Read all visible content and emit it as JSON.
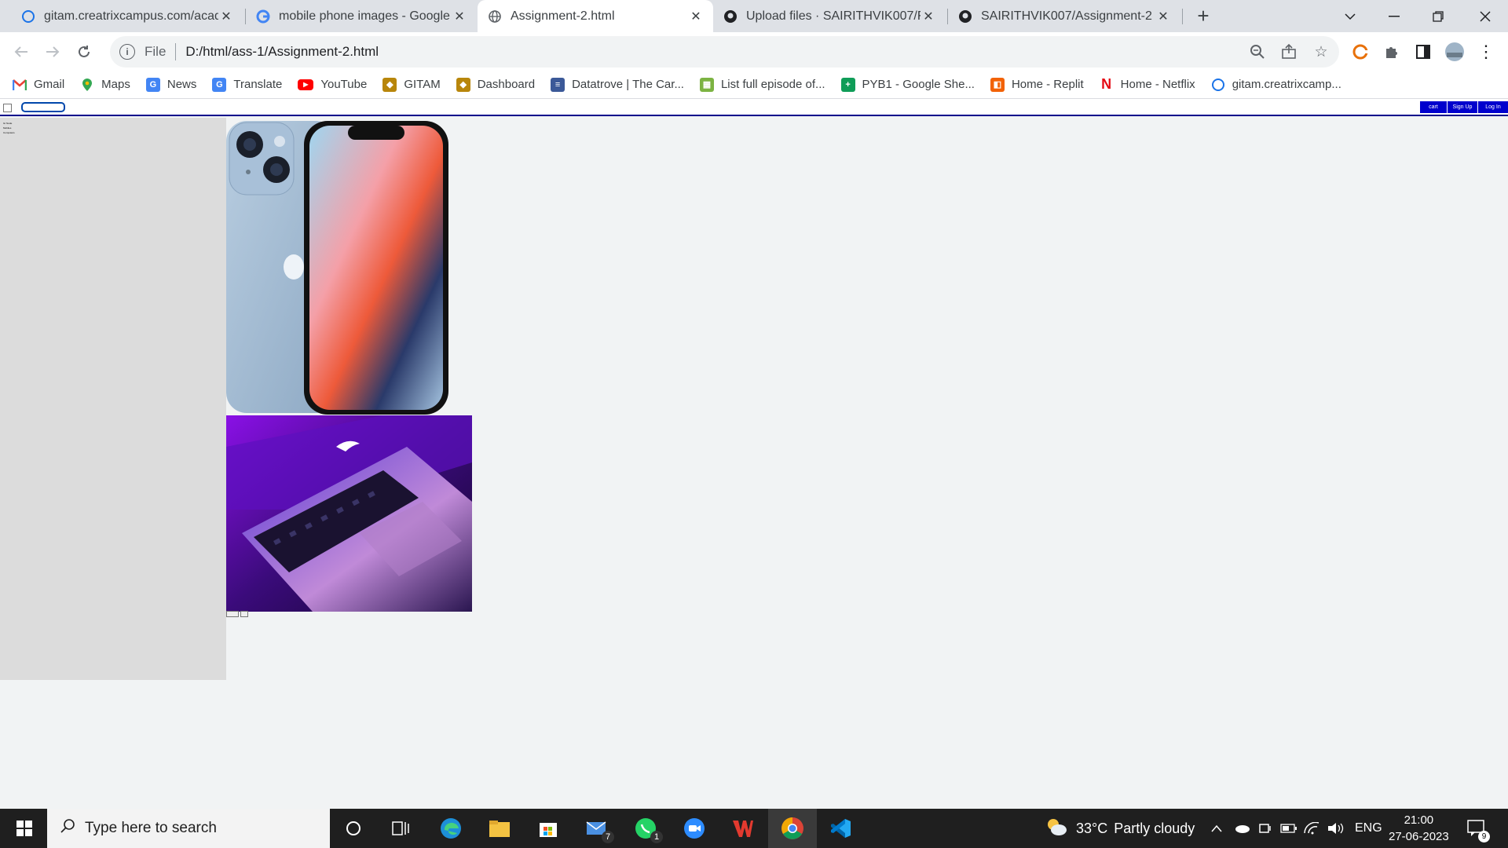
{
  "browser": {
    "tabs": [
      {
        "title": "gitam.creatrixcampus.com/acade",
        "active": false
      },
      {
        "title": "mobile phone images - Google S",
        "active": false
      },
      {
        "title": "Assignment-2.html",
        "active": true
      },
      {
        "title": "Upload files · SAIRITHVIK007/FSD",
        "active": false
      },
      {
        "title": "SAIRITHVIK007/Assignment-2",
        "active": false
      }
    ],
    "new_tab_icon": "+",
    "address": {
      "scheme": "File",
      "url": "D:/html/ass-1/Assignment-2.html"
    },
    "bookmarks": [
      {
        "label": "Gmail",
        "icon": "gmail-icon",
        "color": "#ea4335"
      },
      {
        "label": "Maps",
        "icon": "maps-icon",
        "color": "#34a853"
      },
      {
        "label": "News",
        "icon": "news-icon",
        "color": "#4285f4"
      },
      {
        "label": "Translate",
        "icon": "translate-icon",
        "color": "#4285f4"
      },
      {
        "label": "YouTube",
        "icon": "youtube-icon",
        "color": "#ff0000"
      },
      {
        "label": "GITAM",
        "icon": "gitam-icon",
        "color": "#b8860b"
      },
      {
        "label": "Dashboard",
        "icon": "dashboard-icon",
        "color": "#b8860b"
      },
      {
        "label": "Datatrove | The Car...",
        "icon": "datatrove-icon",
        "color": "#3b5998"
      },
      {
        "label": "List full episode of...",
        "icon": "list-icon",
        "color": "#7cb342"
      },
      {
        "label": "PYB1 - Google She...",
        "icon": "sheets-icon",
        "color": "#0f9d58"
      },
      {
        "label": "Home - Replit",
        "icon": "replit-icon",
        "color": "#f26207"
      },
      {
        "label": "Home - Netflix",
        "icon": "netflix-icon",
        "color": "#e50914"
      },
      {
        "label": "gitam.creatrixcamp...",
        "icon": "creatrix-icon",
        "color": "#1a73e8"
      }
    ]
  },
  "page": {
    "buttons": [
      {
        "label": "cart"
      },
      {
        "label": "Sign Up"
      },
      {
        "label": "Log In"
      }
    ],
    "side_links": [
      {
        "label": "Gr Node"
      },
      {
        "label": "Mobiles"
      },
      {
        "label": "Computers"
      }
    ],
    "images": [
      {
        "name": "iphone-image",
        "depicts": "blue smartphone front and back"
      },
      {
        "name": "laptop-image",
        "depicts": "laptop keyboard with purple lighting"
      }
    ]
  },
  "taskbar": {
    "search_placeholder": "Type here to search",
    "weather": {
      "temp": "33°C",
      "desc": "Partly cloudy"
    },
    "language": "ENG",
    "time": "21:00",
    "date": "27-06-2023",
    "notifications": "9",
    "mail_badge": "7",
    "whatsapp_badge": "1"
  }
}
